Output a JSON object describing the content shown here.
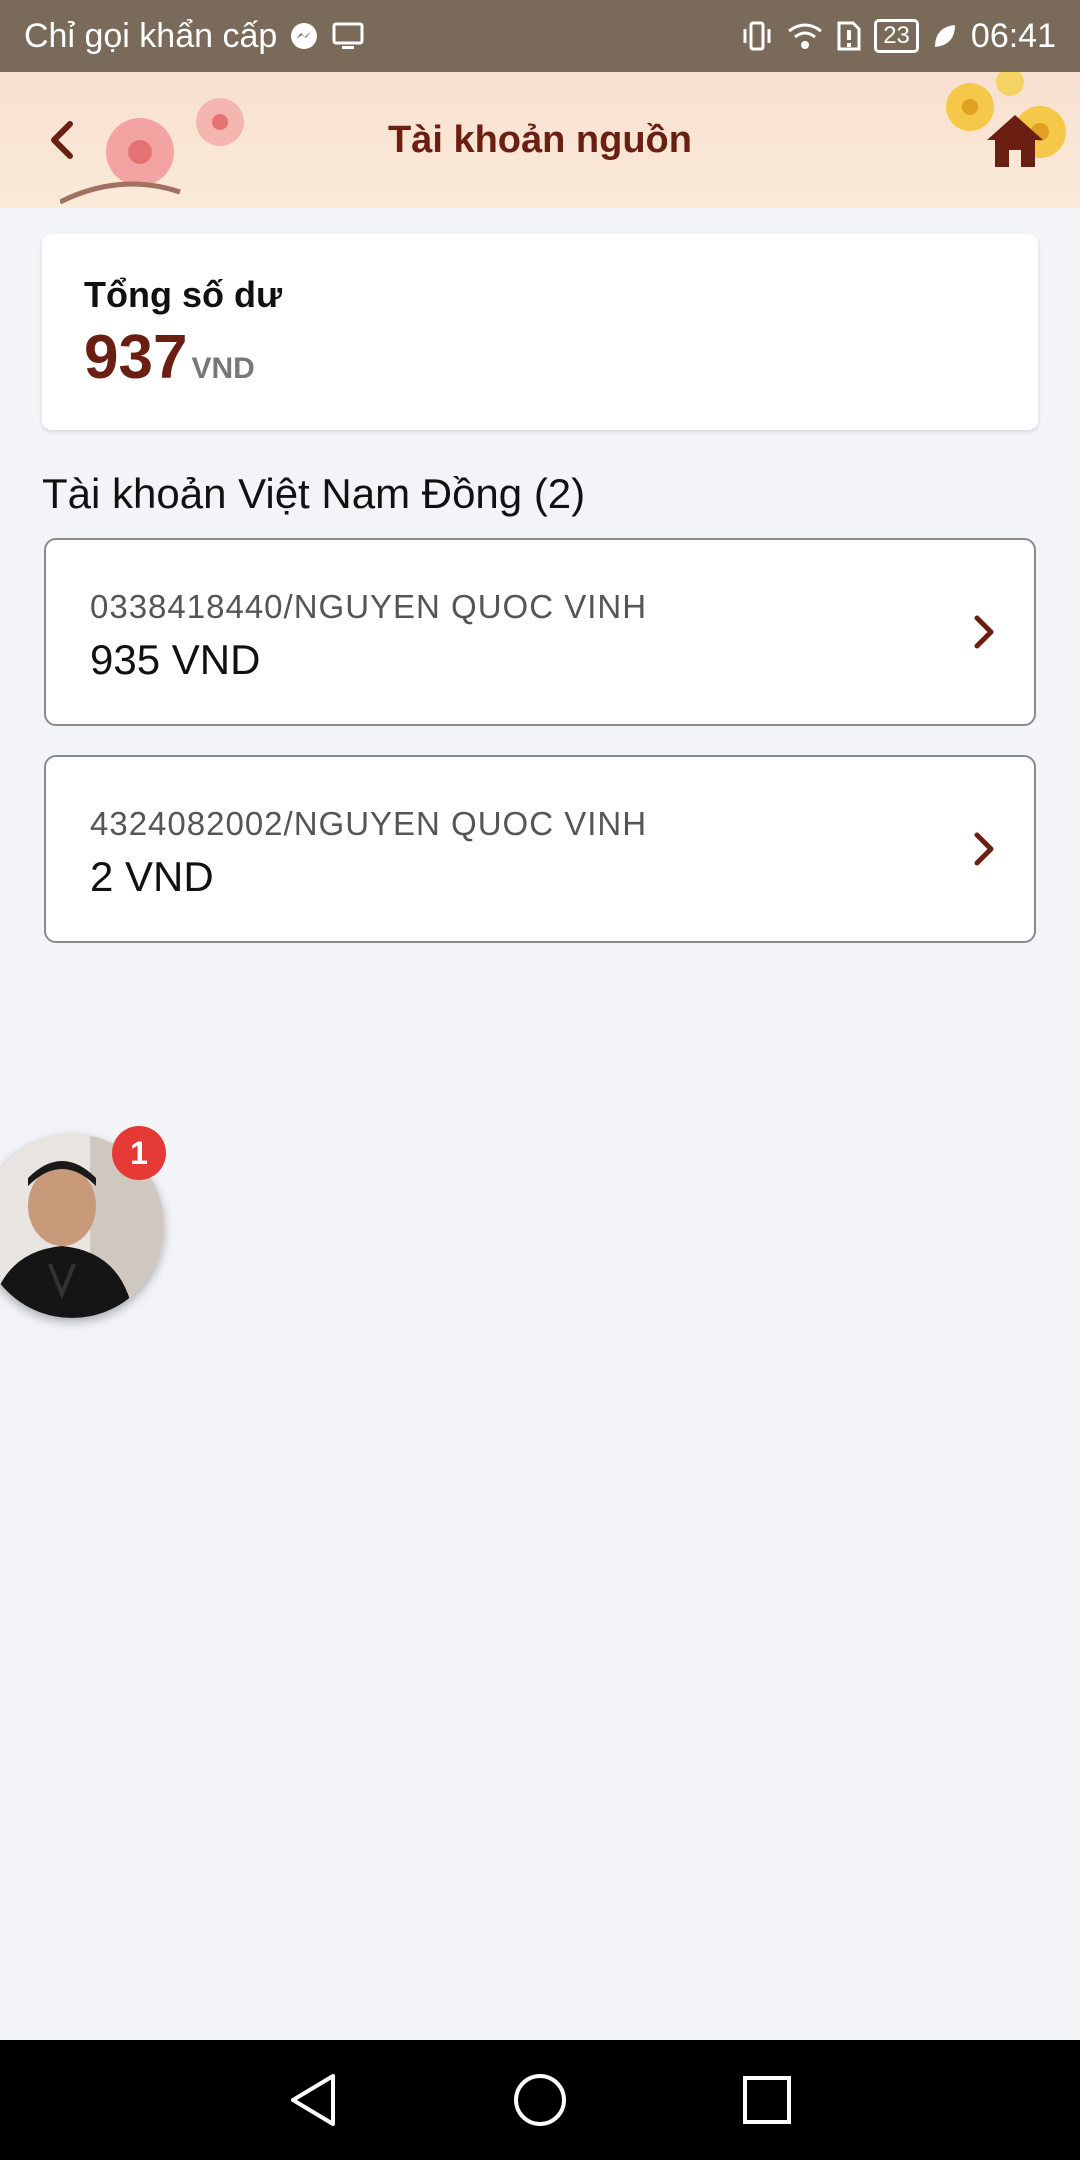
{
  "status_bar": {
    "carrier_text": "Chỉ gọi khẩn cấp",
    "battery": "23",
    "time": "06:41"
  },
  "header": {
    "title": "Tài khoản nguồn",
    "back_icon": "chevron-left-icon",
    "home_icon": "home-icon"
  },
  "total": {
    "label": "Tổng số dư",
    "amount": "937",
    "currency": "VND"
  },
  "section": {
    "title": "Tài khoản Việt Nam Đồng (2)"
  },
  "accounts": [
    {
      "number": "0338418440/NGUYEN QUOC VINH",
      "balance": "935 VND"
    },
    {
      "number": "4324082002/NGUYEN QUOC VINH",
      "balance": "2 VND"
    }
  ],
  "chat_head": {
    "badge_count": "1"
  },
  "colors": {
    "brand": "#6b1f12",
    "badge": "#e53935",
    "background": "#f3f4f8"
  }
}
